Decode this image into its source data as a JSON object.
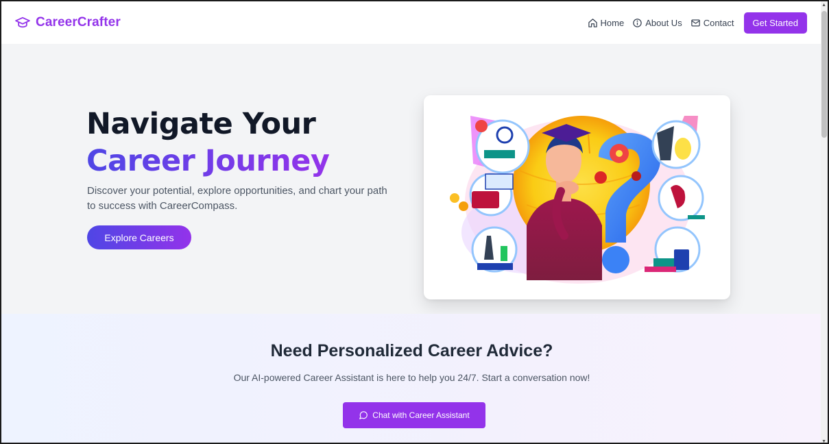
{
  "nav": {
    "brand": "CareerCrafter",
    "links": [
      {
        "label": "Home",
        "icon": "home-icon"
      },
      {
        "label": "About Us",
        "icon": "info-icon"
      },
      {
        "label": "Contact",
        "icon": "mail-icon"
      }
    ],
    "cta": "Get Started"
  },
  "hero": {
    "title_line1": "Navigate Your",
    "title_line2": "Career Journey",
    "subtitle": "Discover your potential, explore opportunities, and chart your path to success with CareerCompass.",
    "button": "Explore Careers"
  },
  "advice": {
    "title": "Need Personalized Career Advice?",
    "subtitle": "Our AI-powered Career Assistant is here to help you 24/7. Start a conversation now!",
    "button": "Chat with Career Assistant"
  },
  "colors": {
    "brand": "#9333ea",
    "gradient_start": "#4f46e5",
    "gradient_end": "#9333ea"
  }
}
